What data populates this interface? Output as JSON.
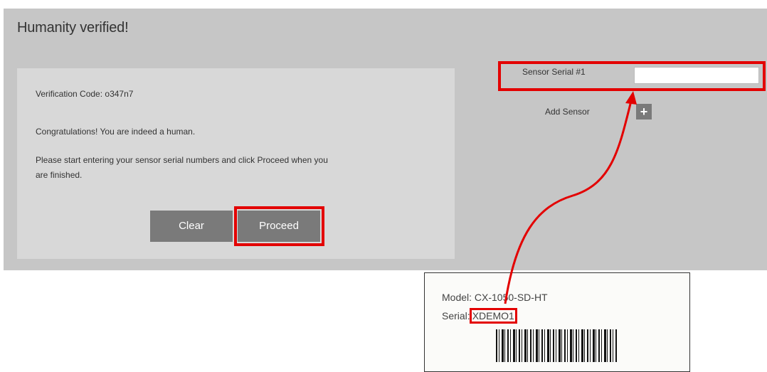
{
  "header": {
    "title": "Humanity verified!"
  },
  "message": {
    "verification": "Verification Code: o347n7",
    "congrats": "Congratulations! You are indeed a human.",
    "instructions_line1": "Please start entering your sensor serial numbers and click Proceed when you",
    "instructions_line2": "are finished."
  },
  "buttons": {
    "clear_label": "Clear",
    "proceed_label": "Proceed"
  },
  "sensor_form": {
    "serial_label": "Sensor Serial #1",
    "serial_value": "",
    "add_label": "Add Sensor",
    "add_icon": "+"
  },
  "device_label": {
    "model": "Model: CX-1050-SD-HT",
    "serial_prefix": "Serial:",
    "serial_code": "XDEMO1"
  },
  "colors": {
    "panel": "#c6c6c6",
    "inner_panel": "#d8d8d8",
    "button": "#7a7a7a",
    "highlight": "#e30000"
  }
}
